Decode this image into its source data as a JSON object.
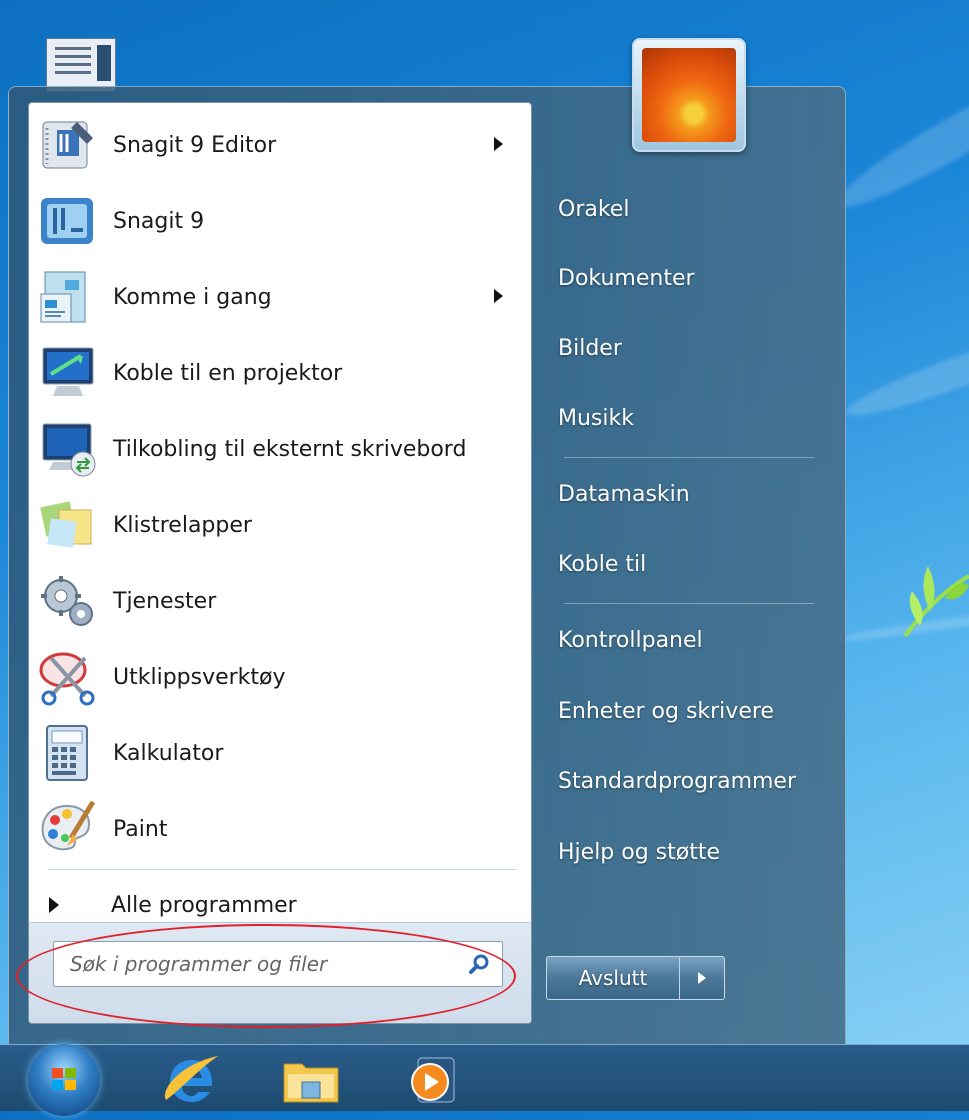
{
  "programs": [
    {
      "label": "Snagit 9 Editor",
      "icon": "snagit-editor-icon",
      "has_submenu": true
    },
    {
      "label": "Snagit 9",
      "icon": "snagit-icon",
      "has_submenu": false
    },
    {
      "label": "Komme i gang",
      "icon": "getting-started-icon",
      "has_submenu": true
    },
    {
      "label": "Koble til en projektor",
      "icon": "projector-icon",
      "has_submenu": false
    },
    {
      "label": "Tilkobling til eksternt skrivebord",
      "icon": "remote-desktop-icon",
      "has_submenu": false
    },
    {
      "label": "Klistrelapper",
      "icon": "sticky-notes-icon",
      "has_submenu": false
    },
    {
      "label": "Tjenester",
      "icon": "services-gear-icon",
      "has_submenu": false
    },
    {
      "label": "Utklippsverktøy",
      "icon": "snipping-tool-icon",
      "has_submenu": false
    },
    {
      "label": "Kalkulator",
      "icon": "calculator-icon",
      "has_submenu": false
    },
    {
      "label": "Paint",
      "icon": "paint-icon",
      "has_submenu": false
    }
  ],
  "all_programs": "Alle programmer",
  "search": {
    "placeholder": "Søk i programmer og filer"
  },
  "right_items": [
    "Orakel",
    "Dokumenter",
    "Bilder",
    "Musikk",
    "Datamaskin",
    "Koble til",
    "Kontrollpanel",
    "Enheter og skrivere",
    "Standardprogrammer",
    "Hjelp og støtte"
  ],
  "shutdown_label": "Avslutt",
  "colors": {
    "highlight_ellipse": "#e0202a"
  }
}
